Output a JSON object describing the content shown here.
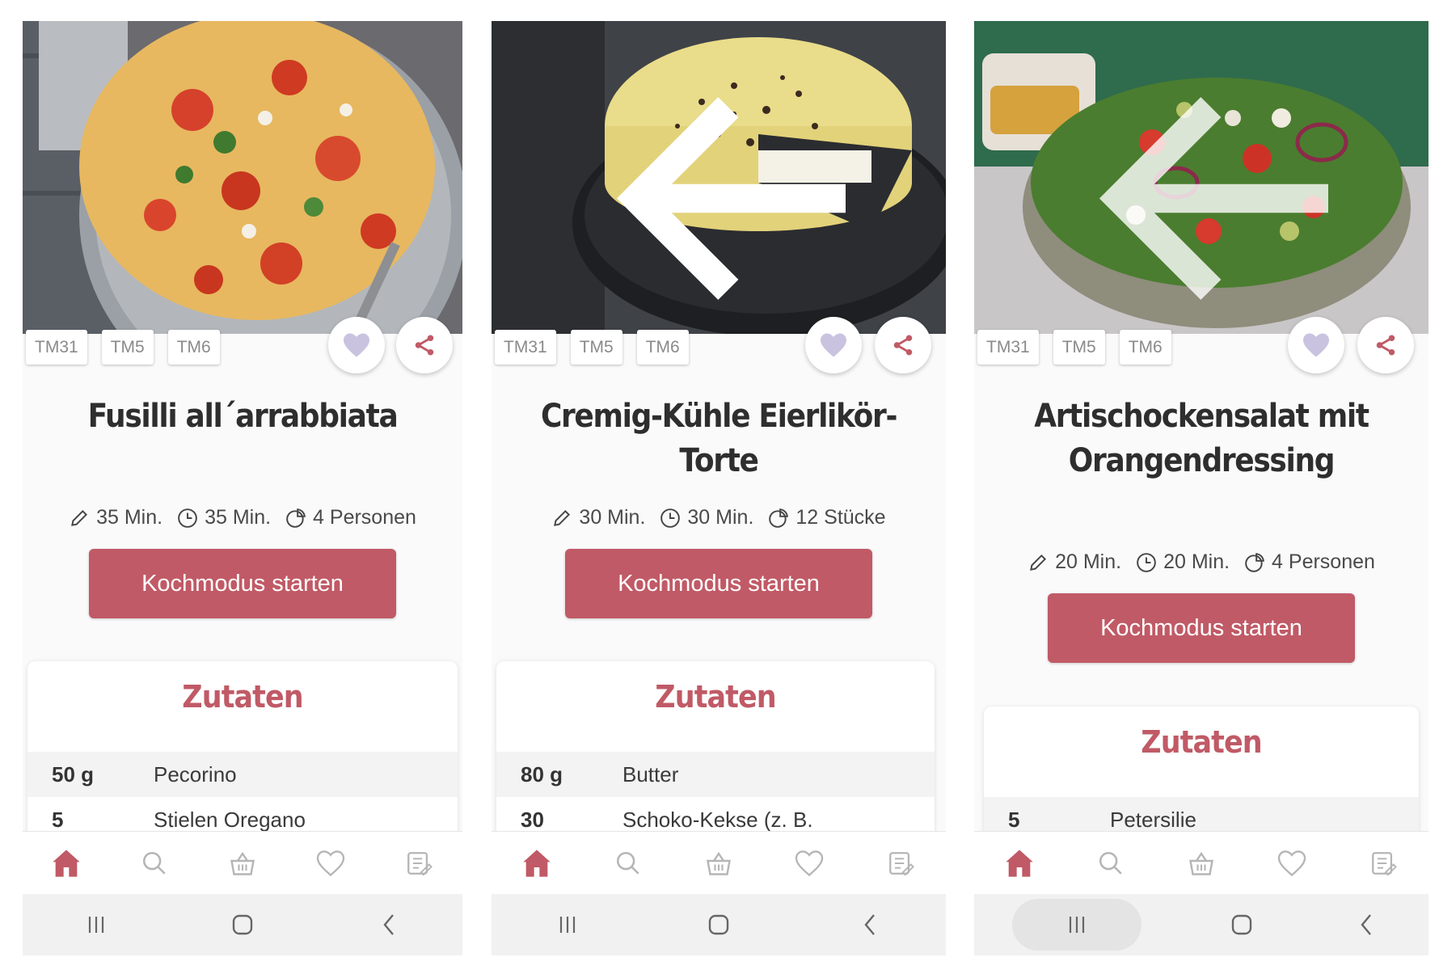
{
  "colors": {
    "accent": "#c05a66",
    "heart": "#c9c3e0",
    "tag_text": "#8a8a8a"
  },
  "screens": [
    {
      "tm_tags": [
        "TM31",
        "TM5",
        "TM6"
      ],
      "title": "Fusilli all´arrabbiata",
      "prep_time": "35 Min.",
      "total_time": "35 Min.",
      "servings": "4 Personen",
      "cook_button": "Kochmodus starten",
      "ingredients_heading": "Zutaten",
      "ingredients": [
        {
          "qty": "50 g",
          "name": "Pecorino"
        },
        {
          "qty": "5",
          "name": "Stielen Oregano"
        }
      ],
      "nav_icons": [
        "home-icon",
        "search-icon",
        "basket-icon",
        "heart-icon",
        "list-icon"
      ]
    },
    {
      "tm_tags": [
        "TM31",
        "TM5",
        "TM6"
      ],
      "title": "Cremig-Kühle Eierlikör-Torte",
      "prep_time": "30 Min.",
      "total_time": "30 Min.",
      "servings": "12 Stücke",
      "cook_button": "Kochmodus starten",
      "ingredients_heading": "Zutaten",
      "ingredients": [
        {
          "qty": "80 g",
          "name": "Butter"
        },
        {
          "qty": "30",
          "name": "Schoko-Kekse (z. B."
        }
      ],
      "nav_icons": [
        "home-icon",
        "search-icon",
        "basket-icon",
        "heart-icon",
        "list-icon"
      ]
    },
    {
      "tm_tags": [
        "TM31",
        "TM5",
        "TM6"
      ],
      "title": "Artischockensalat mit Orangendressing",
      "prep_time": "20 Min.",
      "total_time": "20 Min.",
      "servings": "4 Personen",
      "cook_button": "Kochmodus starten",
      "ingredients_heading": "Zutaten",
      "ingredients": [
        {
          "qty": "5",
          "name": "Petersilie"
        }
      ],
      "nav_icons": [
        "home-icon",
        "search-icon",
        "basket-icon",
        "heart-icon",
        "list-icon"
      ]
    }
  ]
}
